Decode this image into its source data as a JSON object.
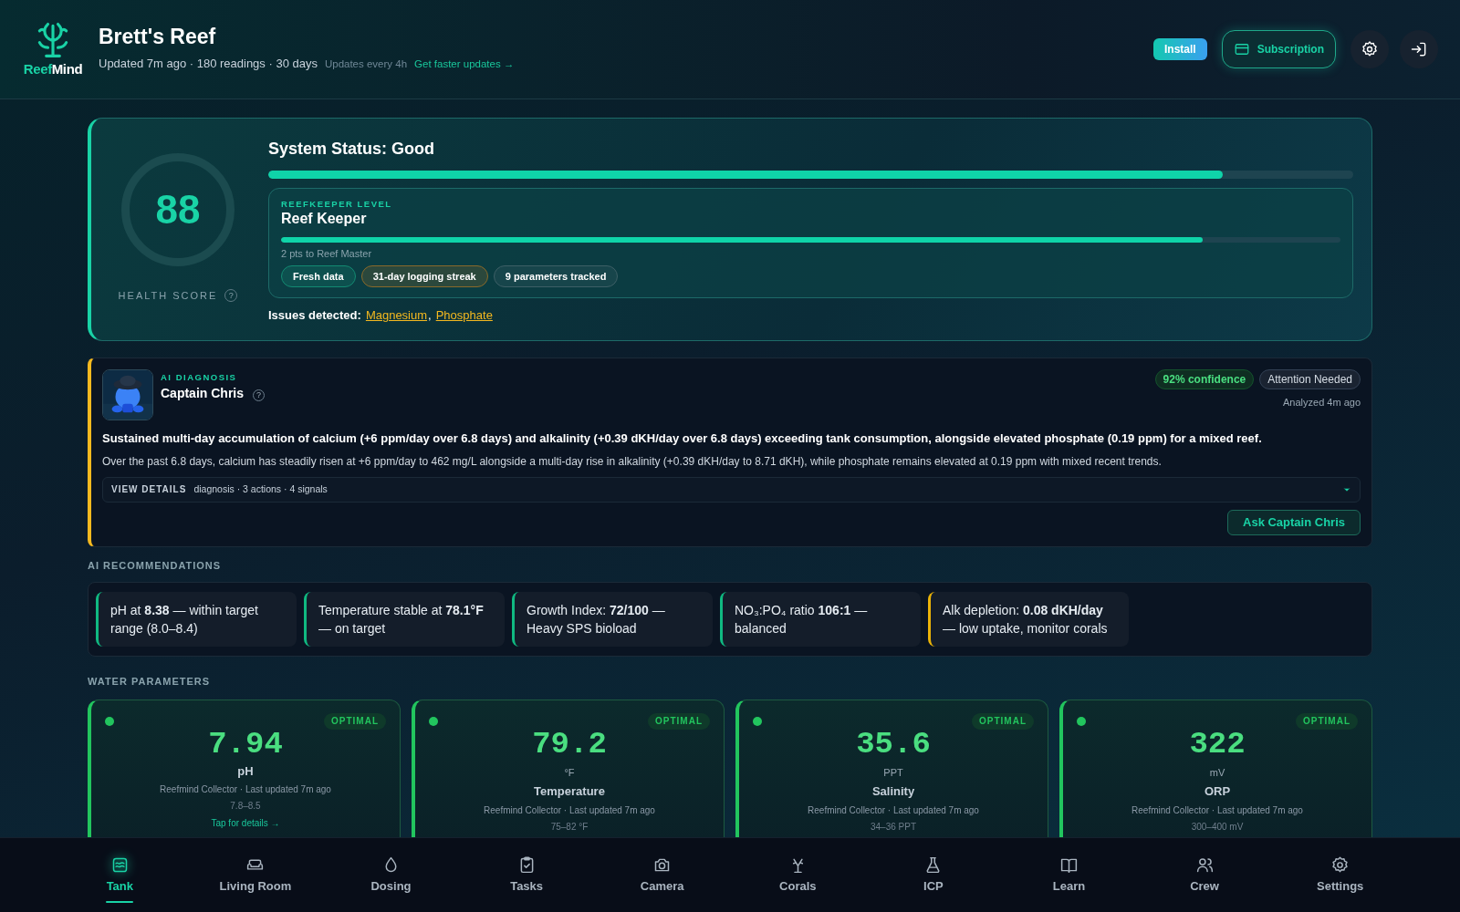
{
  "header": {
    "logo_parts": [
      "Reef",
      "Mind"
    ],
    "title": "Brett's Reef",
    "meta": "Updated 7m ago · 180 readings · 30 days",
    "cadence": "Updates every 4h",
    "upgrade_link": "Get faster updates →",
    "install": "Install",
    "subscription": "Subscription"
  },
  "status": {
    "score": "88",
    "score_label": "HEALTH SCORE",
    "help": "?",
    "title": "System Status: Good",
    "level": 0.88,
    "keeper": {
      "eyebrow": "REEFKEEPER LEVEL",
      "name": "Reef Keeper",
      "level": 0.87,
      "note": "2 pts to Reef Master",
      "chips": [
        {
          "label": "Fresh data",
          "color": "#138a72"
        },
        {
          "label": "31-day logging streak",
          "color": "#8a6a2a"
        },
        {
          "label": "9 parameters tracked",
          "color": "#3d5f66"
        }
      ]
    },
    "issues_label": "Issues detected:",
    "issues": [
      "Magnesium",
      "Phosphate"
    ],
    "issues_separator": ","
  },
  "diagnosis": {
    "eyebrow": "AI DIAGNOSIS",
    "name": "Captain Chris",
    "help": "?",
    "confidence": "92% confidence",
    "badge": "Attention Needed",
    "analyzed": "Analyzed 4m ago",
    "headline": "Sustained multi-day accumulation of calcium (+6 ppm/day over 6.8 days) and alkalinity (+0.39 dKH/day over 6.8 days) exceeding tank consumption, alongside elevated phosphate (0.19 ppm) for a mixed reef.",
    "body": "Over the past 6.8 days, calcium has steadily risen at +6 ppm/day to 462 mg/L alongside a multi-day rise in alkalinity (+0.39 dKH/day to 8.71 dKH), while phosphate remains elevated at 0.19 ppm with mixed recent trends.",
    "details_label": "VIEW DETAILS",
    "details_summary": "diagnosis · 3 actions · 4 signals",
    "expanded": false,
    "ask": "Ask Captain Chris"
  },
  "recommendations": {
    "heading": "AI RECOMMENDATIONS",
    "items": [
      {
        "text": "pH at **8.38** — within target range (8.0–8.4)",
        "color": "#10b981"
      },
      {
        "text": "Temperature stable at **78.1°F** — on target",
        "color": "#10b981"
      },
      {
        "text": "Growth Index: **72/100** — Heavy SPS bioload",
        "color": "#10b981"
      },
      {
        "text": "NO₃:PO₄ ratio **106:1** — balanced",
        "color": "#10b981"
      },
      {
        "text": "Alk depletion: **0.08 dKH/day** — low uptake, monitor corals",
        "color": "#eab308"
      }
    ]
  },
  "water_parameters": {
    "heading": "WATER PARAMETERS",
    "cards": [
      {
        "status": "OPTIMAL",
        "color": "#22c55e",
        "value": "7.94",
        "name": "pH",
        "source": "Reefmind Collector · Last updated 7m ago",
        "range": "7.8–8.5",
        "details": "Tap for details →"
      },
      {
        "status": "OPTIMAL",
        "color": "#22c55e",
        "value": "79.2",
        "unit": "°F",
        "name": "Temperature",
        "source": "Reefmind Collector · Last updated 7m ago",
        "range": "75–82 °F"
      },
      {
        "status": "OPTIMAL",
        "color": "#22c55e",
        "value": "35.6",
        "unit": "PPT",
        "name": "Salinity",
        "source": "Reefmind Collector · Last updated 7m ago",
        "range": "34–36 PPT"
      },
      {
        "status": "OPTIMAL",
        "color": "#22c55e",
        "value": "322",
        "unit": "mV",
        "name": "ORP",
        "source": "Reefmind Collector · Last updated 7m ago",
        "range": "300–400 mV"
      }
    ]
  },
  "nav": [
    {
      "label": "Tank",
      "selected": true
    },
    {
      "label": "Living Room",
      "selected": false
    },
    {
      "label": "Dosing",
      "selected": false
    },
    {
      "label": "Tasks",
      "selected": false
    },
    {
      "label": "Camera",
      "selected": false
    },
    {
      "label": "Corals",
      "selected": false
    },
    {
      "label": "ICP",
      "selected": false
    },
    {
      "label": "Learn",
      "selected": false
    },
    {
      "label": "Crew",
      "selected": false
    },
    {
      "label": "Settings",
      "selected": false
    }
  ]
}
